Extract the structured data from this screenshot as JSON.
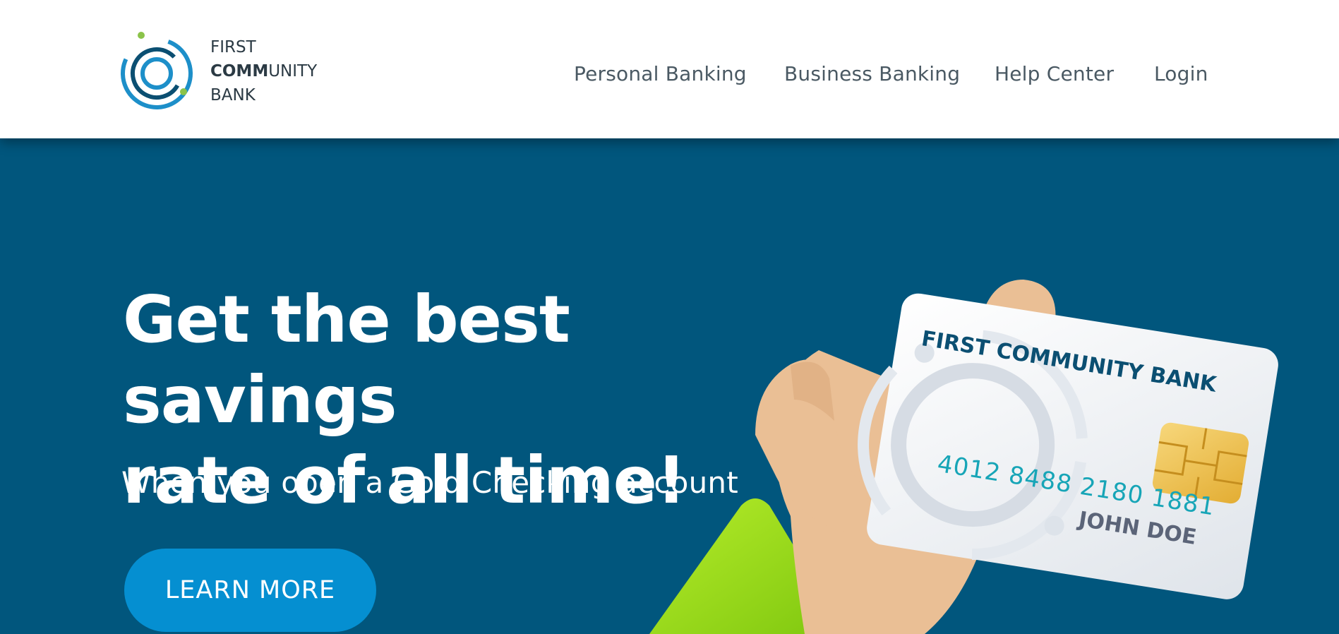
{
  "brand": {
    "name_line1": "FIRST",
    "name_line2_bold": "COMM",
    "name_line2_rest": "UNITY",
    "name_line3": "BANK",
    "colors": {
      "ring_blue": "#1d8fc9",
      "ring_dark": "#0b4f72",
      "dot_green": "#8bc34a"
    }
  },
  "nav": {
    "items": [
      {
        "label": "Personal Banking"
      },
      {
        "label": "Business Banking"
      },
      {
        "label": "Help Center"
      },
      {
        "label": "Login"
      }
    ]
  },
  "hero": {
    "headline_line1": "Get the best savings",
    "headline_line2": "rate of all time!",
    "subheadline": "When you open a Gold Checking account",
    "cta_label": "LEARN MORE",
    "background_color": "#01567d",
    "cta_color": "#058fd1"
  },
  "card": {
    "bank_name": "FIRST COMMUNITY BANK",
    "number": "4012 8488 2180 1881",
    "holder": "JOHN DOE"
  }
}
